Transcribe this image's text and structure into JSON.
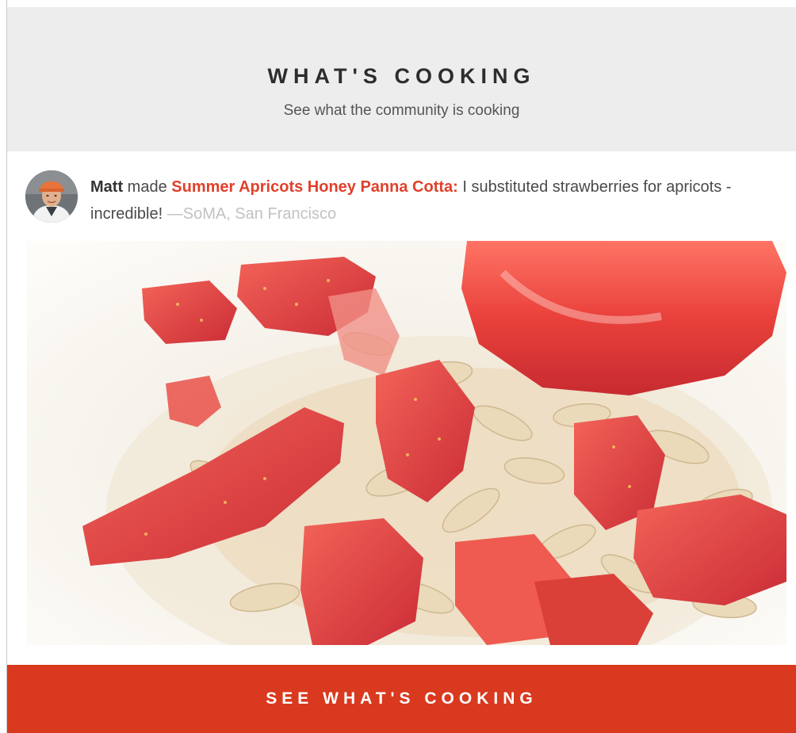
{
  "header": {
    "title": "WHAT'S COOKING",
    "subtitle": "See what the community is cooking"
  },
  "post": {
    "user": "Matt",
    "verb": "made",
    "recipe": "Summer Apricots Honey Panna Cotta",
    "colon": ":",
    "comment": "I substituted strawberries for apricots - incredible!",
    "location": "—SoMA, San Francisco"
  },
  "cta": {
    "label": "SEE WHAT'S COOKING"
  },
  "colors": {
    "accent": "#d9391e",
    "recipe_link": "#e0402b",
    "header_bg": "#ededed"
  }
}
